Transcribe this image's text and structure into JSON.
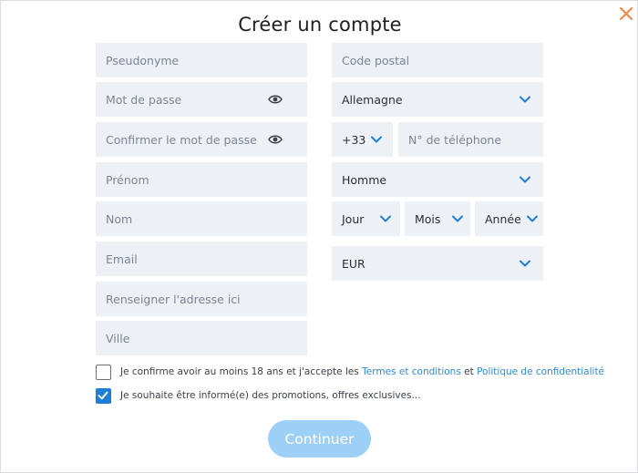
{
  "title": "Créer un compte",
  "fields": {
    "pseudonyme": "Pseudonyme",
    "password": "Mot de passe",
    "confirm_password": "Confirmer le mot de passe",
    "prenom": "Prénom",
    "nom": "Nom",
    "email": "Email",
    "address": "Renseigner l'adresse ici",
    "ville": "Ville",
    "postal_code": "Code postal",
    "phone": "N° de téléphone"
  },
  "selects": {
    "country": "Allemagne",
    "dial_code": "+33",
    "gender": "Homme",
    "day": "Jour",
    "month": "Mois",
    "year": "Année",
    "currency": "EUR"
  },
  "checkboxes": {
    "terms": {
      "checked": false,
      "text_before": "Je confirme avoir au moins 18 ans et j'accepte les ",
      "link1": "Termes et conditions",
      "text_mid": " et ",
      "link2": "Politique de confidentialité"
    },
    "promo": {
      "checked": true,
      "text": "Je souhaite être informé(e) des promotions, offres exclusives..."
    }
  },
  "continue_label": "Continuer",
  "colors": {
    "field_bg": "#edf1f5",
    "accent": "#1f7fd6",
    "link": "#2e8ad8",
    "button_bg": "#9dd0f7",
    "close_icon": "#f08a4b"
  },
  "icons": {
    "close": "close-icon",
    "eye": "eye-icon",
    "chevron": "chevron-down-icon",
    "check": "checkmark-icon"
  }
}
